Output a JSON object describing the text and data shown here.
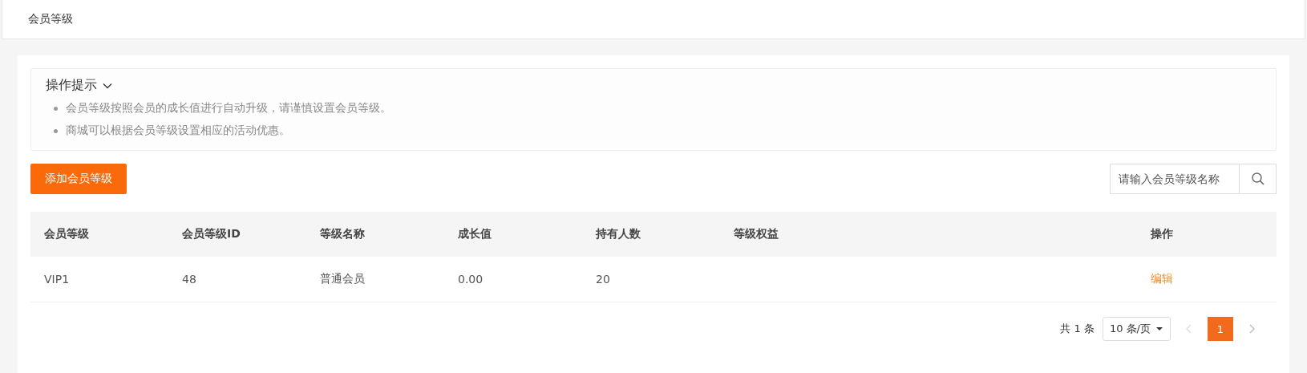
{
  "page_title": "会员等级",
  "tips": {
    "title": "操作提示",
    "expanded": true,
    "items": [
      "会员等级按照会员的成长值进行自动升级，请谨慎设置会员等级。",
      "商城可以根据会员等级设置相应的活动优惠。"
    ]
  },
  "add_button": "添加会员等级",
  "search": {
    "placeholder": "请输入会员等级名称"
  },
  "table": {
    "columns": [
      "会员等级",
      "会员等级ID",
      "等级名称",
      "成长值",
      "持有人数",
      "等级权益",
      "操作"
    ],
    "rows": [
      {
        "cells": [
          "VIP1",
          "48",
          "普通会员",
          "0.00",
          "20",
          ""
        ],
        "action": "编辑"
      }
    ]
  },
  "pagination": {
    "total": "共 1 条",
    "page_size": "10 条/页",
    "pages": [
      {
        "label": "1",
        "selected": true
      }
    ]
  }
}
